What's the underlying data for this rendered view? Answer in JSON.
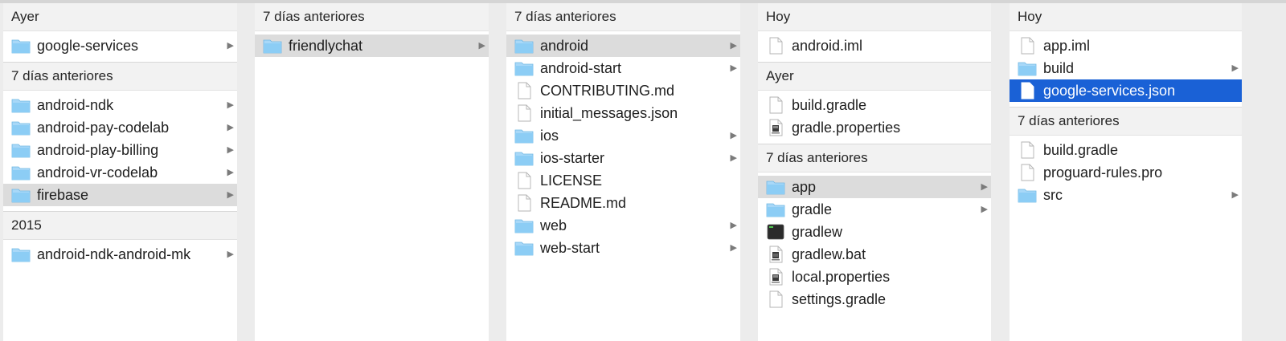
{
  "columns": [
    {
      "sections": [
        {
          "header": "Ayer",
          "items": [
            {
              "name": "google-services",
              "type": "folder",
              "chevron": true
            }
          ]
        },
        {
          "header": "7 días anteriores",
          "items": [
            {
              "name": "android-ndk",
              "type": "folder",
              "chevron": true
            },
            {
              "name": "android-pay-codelab",
              "type": "folder",
              "chevron": true
            },
            {
              "name": "android-play-billing",
              "type": "folder",
              "chevron": true
            },
            {
              "name": "android-vr-codelab",
              "type": "folder",
              "chevron": true
            },
            {
              "name": "firebase",
              "type": "folder",
              "chevron": true,
              "selected": "grey"
            }
          ]
        },
        {
          "header": "2015",
          "items": [
            {
              "name": "android-ndk-android-mk",
              "type": "folder",
              "chevron": true
            }
          ]
        }
      ]
    },
    {
      "sections": [
        {
          "header": "7 días anteriores",
          "items": [
            {
              "name": "friendlychat",
              "type": "folder",
              "chevron": true,
              "selected": "grey"
            }
          ]
        }
      ]
    },
    {
      "sections": [
        {
          "header": "7 días anteriores",
          "items": [
            {
              "name": "android",
              "type": "folder",
              "chevron": true,
              "selected": "grey"
            },
            {
              "name": "android-start",
              "type": "folder",
              "chevron": true
            },
            {
              "name": "CONTRIBUTING.md",
              "type": "file"
            },
            {
              "name": "initial_messages.json",
              "type": "file"
            },
            {
              "name": "ios",
              "type": "folder",
              "chevron": true
            },
            {
              "name": "ios-starter",
              "type": "folder",
              "chevron": true
            },
            {
              "name": "LICENSE",
              "type": "file"
            },
            {
              "name": "README.md",
              "type": "file"
            },
            {
              "name": "web",
              "type": "folder",
              "chevron": true
            },
            {
              "name": "web-start",
              "type": "folder",
              "chevron": true
            }
          ]
        }
      ]
    },
    {
      "sections": [
        {
          "header": "Hoy",
          "items": [
            {
              "name": "android.iml",
              "type": "file"
            }
          ]
        },
        {
          "header": "Ayer",
          "items": [
            {
              "name": "build.gradle",
              "type": "file"
            },
            {
              "name": "gradle.properties",
              "type": "java-file"
            }
          ]
        },
        {
          "header": "7 días anteriores",
          "items": [
            {
              "name": "app",
              "type": "folder",
              "chevron": true,
              "selected": "grey"
            },
            {
              "name": "gradle",
              "type": "folder",
              "chevron": true
            },
            {
              "name": "gradlew",
              "type": "exec"
            },
            {
              "name": "gradlew.bat",
              "type": "batch-file"
            },
            {
              "name": "local.properties",
              "type": "java-file"
            },
            {
              "name": "settings.gradle",
              "type": "file"
            }
          ]
        }
      ]
    },
    {
      "sections": [
        {
          "header": "Hoy",
          "items": [
            {
              "name": "app.iml",
              "type": "file"
            },
            {
              "name": "build",
              "type": "folder",
              "chevron": true
            },
            {
              "name": "google-services.json",
              "type": "file",
              "selected": "blue"
            }
          ]
        },
        {
          "header": "7 días anteriores",
          "items": [
            {
              "name": "build.gradle",
              "type": "file"
            },
            {
              "name": "proguard-rules.pro",
              "type": "file"
            },
            {
              "name": "src",
              "type": "folder",
              "chevron": true
            }
          ]
        }
      ]
    }
  ],
  "icons": {
    "folder": "folder-icon",
    "file": "document-icon",
    "java-file": "java-document-icon",
    "batch-file": "batch-document-icon",
    "exec": "terminal-exec-icon",
    "chevron": "chevron-right-icon"
  },
  "colors": {
    "selection_blue": "#1a61d6",
    "selection_grey": "#dcdcdc",
    "folder": "#7cc4f0"
  }
}
